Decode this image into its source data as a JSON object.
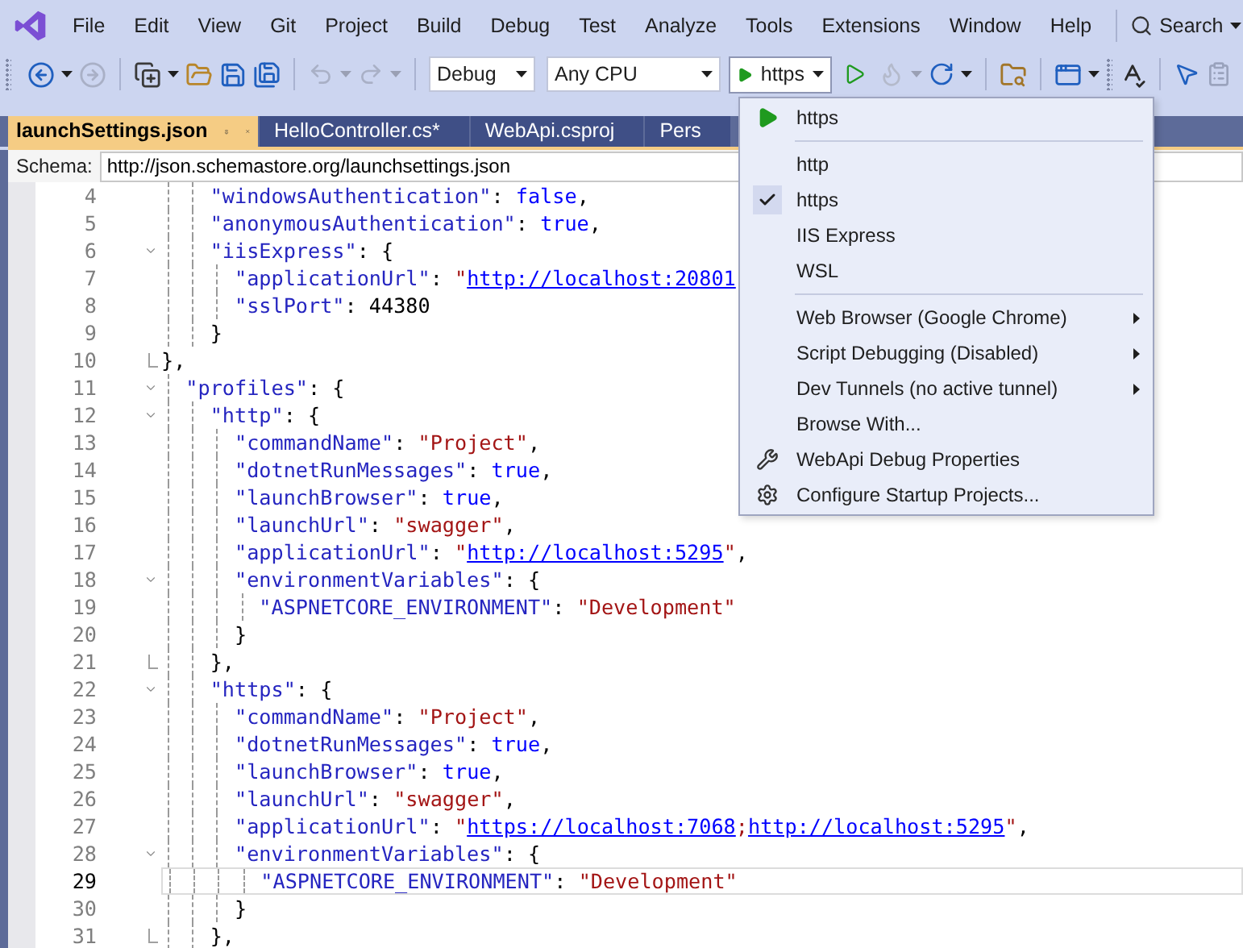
{
  "menu": [
    "File",
    "Edit",
    "View",
    "Git",
    "Project",
    "Build",
    "Debug",
    "Test",
    "Analyze",
    "Tools",
    "Extensions",
    "Window",
    "Help"
  ],
  "search": {
    "label": "Search"
  },
  "toolbar": {
    "configuration": "Debug",
    "platform": "Any CPU",
    "startup": "https"
  },
  "tabs": [
    {
      "label": "launchSettings.json",
      "selected": true
    },
    {
      "label": "HelloController.cs*",
      "selected": false
    },
    {
      "label": "WebApi.csproj",
      "selected": false
    },
    {
      "label": "Pers",
      "selected": false
    }
  ],
  "schema": {
    "label": "Schema:",
    "value": "http://json.schemastore.org/launchsettings.json"
  },
  "lines": [
    {
      "number": "4",
      "current": false,
      "tokens": [
        {
          "kind": "key",
          "text": "    \"windowsAuthentication\""
        },
        {
          "kind": "punct",
          "text": ": "
        },
        {
          "kind": "keyword",
          "text": "false"
        },
        {
          "kind": "punct",
          "text": ","
        }
      ]
    },
    {
      "number": "5",
      "current": false,
      "tokens": [
        {
          "kind": "key",
          "text": "    \"anonymousAuthentication\""
        },
        {
          "kind": "punct",
          "text": ": "
        },
        {
          "kind": "keyword",
          "text": "true"
        },
        {
          "kind": "punct",
          "text": ","
        }
      ]
    },
    {
      "number": "6",
      "current": false,
      "foldable": true,
      "tokens": [
        {
          "kind": "key",
          "text": "    \"iisExpress\""
        },
        {
          "kind": "punct",
          "text": ": {"
        }
      ]
    },
    {
      "number": "7",
      "current": false,
      "tokens": [
        {
          "kind": "key",
          "text": "      \"applicationUrl\""
        },
        {
          "kind": "punct",
          "text": ": "
        },
        {
          "kind": "string",
          "text": "\""
        },
        {
          "kind": "link",
          "text": "http://localhost:20801"
        }
      ]
    },
    {
      "number": "8",
      "current": false,
      "tokens": [
        {
          "kind": "key",
          "text": "      \"sslPort\""
        },
        {
          "kind": "punct",
          "text": ": "
        },
        {
          "kind": "number",
          "text": "44380"
        }
      ]
    },
    {
      "number": "9",
      "current": false,
      "tokens": [
        {
          "kind": "punct",
          "text": "    }"
        }
      ]
    },
    {
      "number": "10",
      "current": false,
      "fold_end": true,
      "tokens": [
        {
          "kind": "punct",
          "text": "},"
        }
      ]
    },
    {
      "number": "11",
      "current": false,
      "foldable": true,
      "tokens": [
        {
          "kind": "key",
          "text": "  \"profiles\""
        },
        {
          "kind": "punct",
          "text": ": {"
        }
      ]
    },
    {
      "number": "12",
      "current": false,
      "foldable": true,
      "tokens": [
        {
          "kind": "key",
          "text": "    \"http\""
        },
        {
          "kind": "punct",
          "text": ": {"
        }
      ]
    },
    {
      "number": "13",
      "current": false,
      "tokens": [
        {
          "kind": "key",
          "text": "      \"commandName\""
        },
        {
          "kind": "punct",
          "text": ": "
        },
        {
          "kind": "string",
          "text": "\"Project\""
        },
        {
          "kind": "punct",
          "text": ","
        }
      ]
    },
    {
      "number": "14",
      "current": false,
      "tokens": [
        {
          "kind": "key",
          "text": "      \"dotnetRunMessages\""
        },
        {
          "kind": "punct",
          "text": ": "
        },
        {
          "kind": "keyword",
          "text": "true"
        },
        {
          "kind": "punct",
          "text": ","
        }
      ]
    },
    {
      "number": "15",
      "current": false,
      "tokens": [
        {
          "kind": "key",
          "text": "      \"launchBrowser\""
        },
        {
          "kind": "punct",
          "text": ": "
        },
        {
          "kind": "keyword",
          "text": "true"
        },
        {
          "kind": "punct",
          "text": ","
        }
      ]
    },
    {
      "number": "16",
      "current": false,
      "tokens": [
        {
          "kind": "key",
          "text": "      \"launchUrl\""
        },
        {
          "kind": "punct",
          "text": ": "
        },
        {
          "kind": "string",
          "text": "\"swagger\""
        },
        {
          "kind": "punct",
          "text": ","
        }
      ]
    },
    {
      "number": "17",
      "current": false,
      "tokens": [
        {
          "kind": "key",
          "text": "      \"applicationUrl\""
        },
        {
          "kind": "punct",
          "text": ": "
        },
        {
          "kind": "string",
          "text": "\""
        },
        {
          "kind": "link",
          "text": "http://localhost:5295"
        },
        {
          "kind": "string",
          "text": "\""
        },
        {
          "kind": "punct",
          "text": ","
        }
      ]
    },
    {
      "number": "18",
      "current": false,
      "foldable": true,
      "tokens": [
        {
          "kind": "key",
          "text": "      \"environmentVariables\""
        },
        {
          "kind": "punct",
          "text": ": {"
        }
      ]
    },
    {
      "number": "19",
      "current": false,
      "tokens": [
        {
          "kind": "key",
          "text": "        \"ASPNETCORE_ENVIRONMENT\""
        },
        {
          "kind": "punct",
          "text": ": "
        },
        {
          "kind": "string",
          "text": "\"Development\""
        }
      ]
    },
    {
      "number": "20",
      "current": false,
      "tokens": [
        {
          "kind": "punct",
          "text": "      }"
        }
      ]
    },
    {
      "number": "21",
      "current": false,
      "fold_end": true,
      "tokens": [
        {
          "kind": "punct",
          "text": "    },"
        }
      ]
    },
    {
      "number": "22",
      "current": false,
      "foldable": true,
      "tokens": [
        {
          "kind": "key",
          "text": "    \"https\""
        },
        {
          "kind": "punct",
          "text": ": {"
        }
      ]
    },
    {
      "number": "23",
      "current": false,
      "tokens": [
        {
          "kind": "key",
          "text": "      \"commandName\""
        },
        {
          "kind": "punct",
          "text": ": "
        },
        {
          "kind": "string",
          "text": "\"Project\""
        },
        {
          "kind": "punct",
          "text": ","
        }
      ]
    },
    {
      "number": "24",
      "current": false,
      "tokens": [
        {
          "kind": "key",
          "text": "      \"dotnetRunMessages\""
        },
        {
          "kind": "punct",
          "text": ": "
        },
        {
          "kind": "keyword",
          "text": "true"
        },
        {
          "kind": "punct",
          "text": ","
        }
      ]
    },
    {
      "number": "25",
      "current": false,
      "tokens": [
        {
          "kind": "key",
          "text": "      \"launchBrowser\""
        },
        {
          "kind": "punct",
          "text": ": "
        },
        {
          "kind": "keyword",
          "text": "true"
        },
        {
          "kind": "punct",
          "text": ","
        }
      ]
    },
    {
      "number": "26",
      "current": false,
      "tokens": [
        {
          "kind": "key",
          "text": "      \"launchUrl\""
        },
        {
          "kind": "punct",
          "text": ": "
        },
        {
          "kind": "string",
          "text": "\"swagger\""
        },
        {
          "kind": "punct",
          "text": ","
        }
      ]
    },
    {
      "number": "27",
      "current": false,
      "tokens": [
        {
          "kind": "key",
          "text": "      \"applicationUrl\""
        },
        {
          "kind": "punct",
          "text": ": "
        },
        {
          "kind": "string",
          "text": "\""
        },
        {
          "kind": "link",
          "text": "https://localhost:7068"
        },
        {
          "kind": "string",
          "text": ";"
        },
        {
          "kind": "link",
          "text": "http://localhost:5295"
        },
        {
          "kind": "string",
          "text": "\""
        },
        {
          "kind": "punct",
          "text": ","
        }
      ]
    },
    {
      "number": "28",
      "current": false,
      "foldable": true,
      "tokens": [
        {
          "kind": "key",
          "text": "      \"environmentVariables\""
        },
        {
          "kind": "punct",
          "text": ": {"
        }
      ]
    },
    {
      "number": "29",
      "current": true,
      "tokens": [
        {
          "kind": "key",
          "text": "        \"ASPNETCORE_ENVIRONMENT\""
        },
        {
          "kind": "punct",
          "text": ": "
        },
        {
          "kind": "string",
          "text": "\"Development\""
        }
      ]
    },
    {
      "number": "30",
      "current": false,
      "tokens": [
        {
          "kind": "punct",
          "text": "      }"
        }
      ]
    },
    {
      "number": "31",
      "current": false,
      "fold_end": true,
      "tokens": [
        {
          "kind": "punct",
          "text": "    },"
        }
      ]
    }
  ],
  "dropdown": [
    {
      "kind": "launch",
      "label": "https"
    },
    {
      "kind": "separator"
    },
    {
      "kind": "profile",
      "label": "http",
      "checked": false
    },
    {
      "kind": "profile",
      "label": "https",
      "checked": true
    },
    {
      "kind": "profile",
      "label": "IIS Express",
      "checked": false
    },
    {
      "kind": "profile",
      "label": "WSL",
      "checked": false
    },
    {
      "kind": "separator"
    },
    {
      "kind": "submenu",
      "label": "Web Browser (Google Chrome)"
    },
    {
      "kind": "submenu",
      "label": "Script Debugging (Disabled)"
    },
    {
      "kind": "submenu",
      "label": "Dev Tunnels (no active tunnel)"
    },
    {
      "kind": "action",
      "label": "Browse With..."
    },
    {
      "kind": "properties",
      "label": "WebApi Debug Properties"
    },
    {
      "kind": "configure",
      "label": "Configure Startup Projects..."
    }
  ]
}
